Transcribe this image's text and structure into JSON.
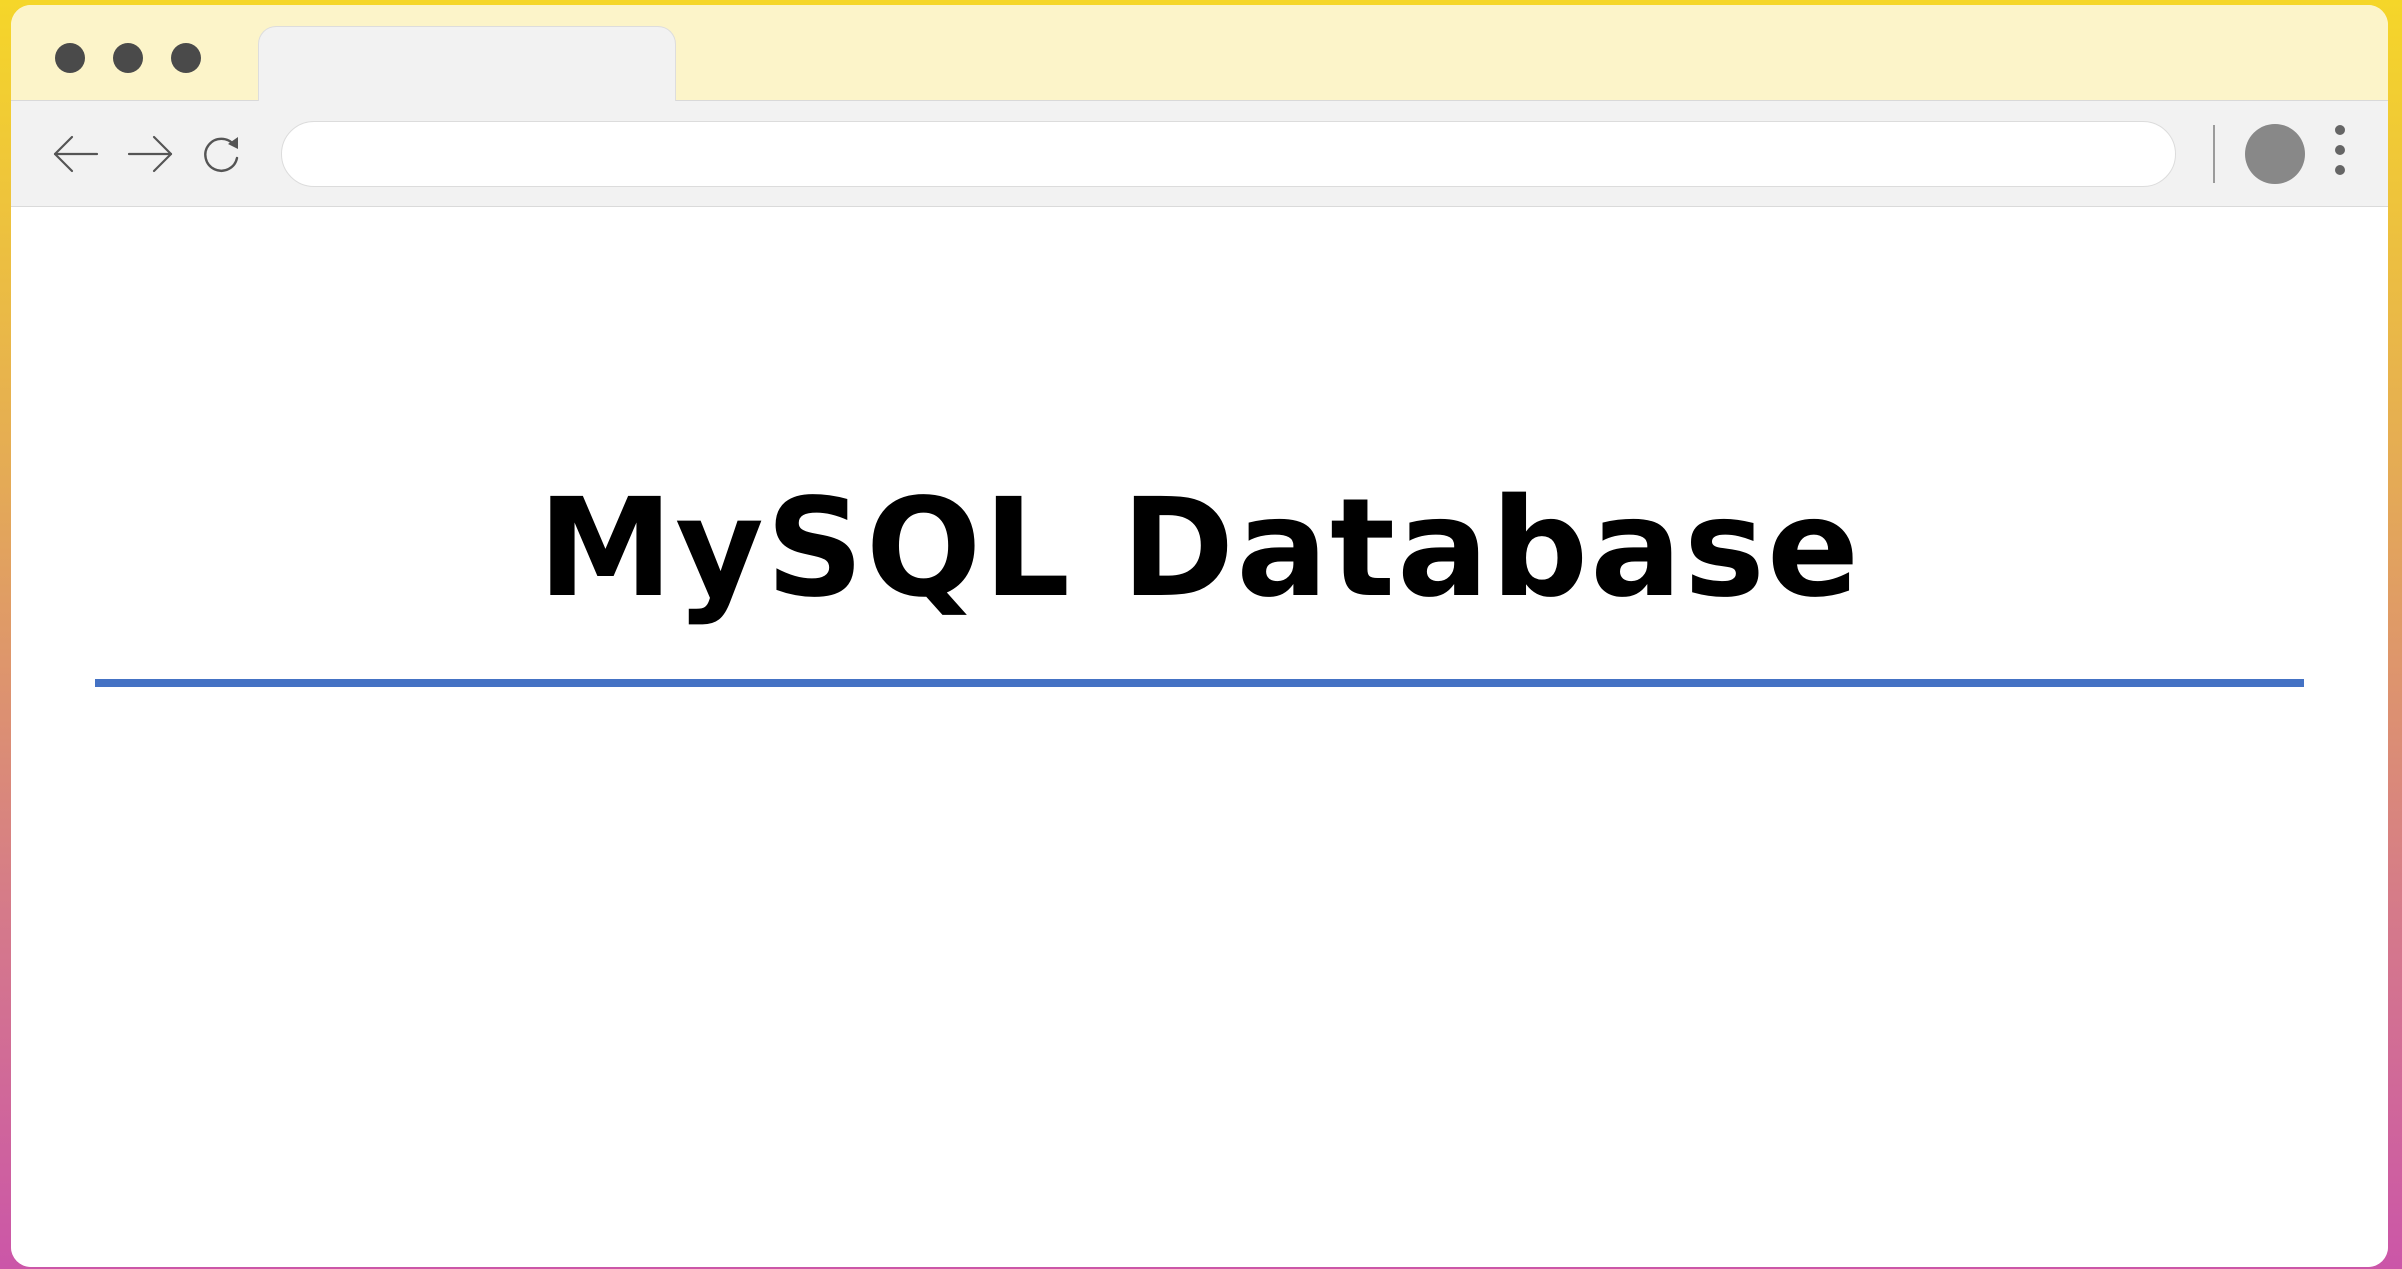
{
  "browser": {
    "tab": {
      "title": ""
    },
    "address_bar": {
      "value": "",
      "placeholder": ""
    },
    "icons": {
      "back": "back-arrow-icon",
      "forward": "forward-arrow-icon",
      "reload": "reload-icon",
      "profile": "profile-avatar",
      "menu": "more-vertical-icon"
    }
  },
  "page": {
    "title": "MySQL Database"
  },
  "colors": {
    "frame_gradient_top": "#f5d629",
    "frame_gradient_bottom": "#cb56a8",
    "tabbar_background": "#fcf4c9",
    "toolbar_background": "#f2f2f2",
    "title_rule": "#4472c4",
    "title_text": "#000000"
  }
}
